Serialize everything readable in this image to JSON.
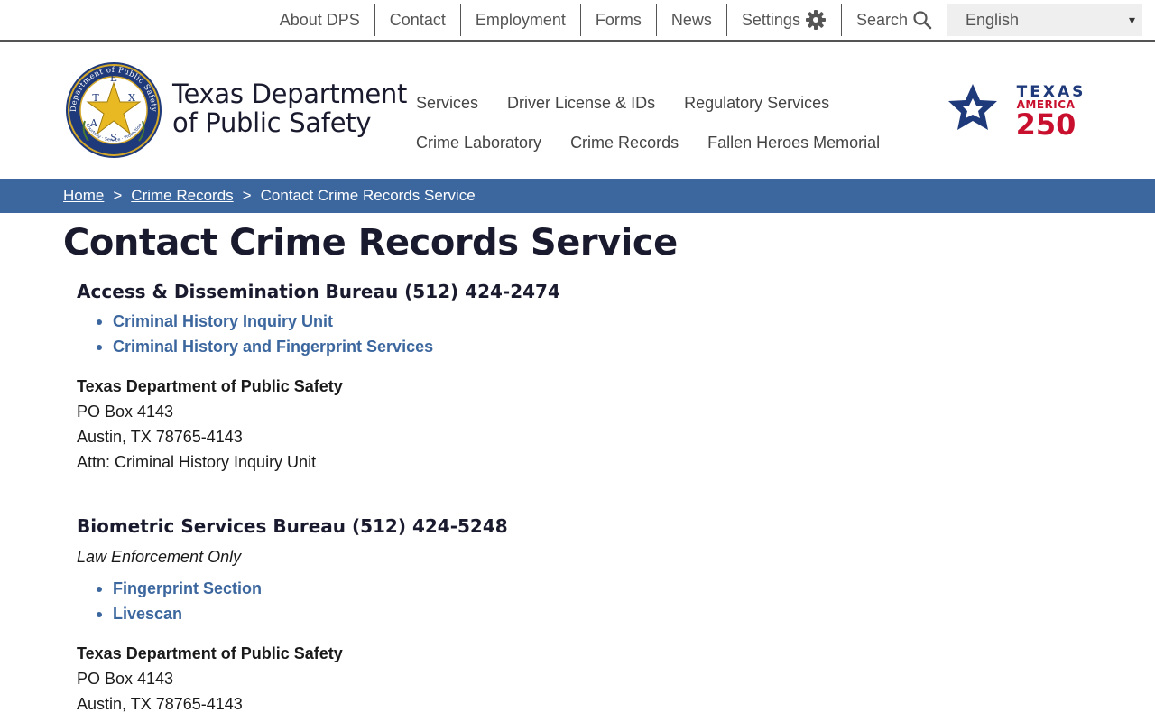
{
  "utility_nav": {
    "links": [
      "About DPS",
      "Contact",
      "Employment",
      "Forms",
      "News"
    ],
    "settings_label": "Settings",
    "search_label": "Search",
    "language": "English"
  },
  "header": {
    "agency_name_line1": "Texas Department",
    "agency_name_line2": "of Public Safety",
    "seal_text": "Department of Public Safety",
    "seal_letters": [
      "T",
      "E",
      "X",
      "A",
      "S"
    ],
    "seal_motto": "Courtesy · Service · Protection",
    "logo250": {
      "line1": "TEXAS",
      "line2": "AMERICA",
      "line3": "250"
    }
  },
  "main_nav": {
    "row1": [
      "Services",
      "Driver License & IDs",
      "Regulatory Services"
    ],
    "row2": [
      "Crime Laboratory",
      "Crime Records",
      "Fallen Heroes Memorial"
    ]
  },
  "breadcrumb": {
    "home": "Home",
    "crime_records": "Crime Records",
    "current": "Contact Crime Records Service",
    "separator": ">"
  },
  "page": {
    "title": "Contact Crime Records Service",
    "sections": [
      {
        "heading": "Access & Dissemination Bureau (512) 424-2474",
        "links": [
          "Criminal History Inquiry Unit",
          "Criminal History and Fingerprint Services"
        ],
        "address": {
          "org": "Texas Department of Public Safety",
          "line1": "PO Box 4143",
          "line2": "Austin, TX 78765-4143",
          "line3": "Attn: Criminal History Inquiry Unit"
        }
      },
      {
        "heading": "Biometric Services Bureau (512) 424-5248",
        "note": "Law Enforcement Only",
        "links": [
          "Fingerprint Section",
          "Livescan"
        ],
        "address": {
          "org": "Texas Department of Public Safety",
          "line1": "PO Box 4143",
          "line2": "Austin, TX 78765-4143"
        }
      }
    ]
  },
  "colors": {
    "brand_blue": "#3b669e",
    "logo_navy": "#1f3a7a",
    "logo_red": "#c8102e"
  }
}
